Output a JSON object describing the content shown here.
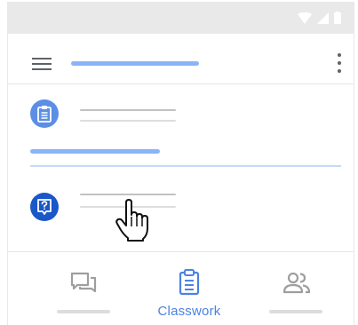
{
  "app_bar": {
    "menu_icon": "menu-icon",
    "more_icon": "more-vert-icon"
  },
  "items": [
    {
      "icon": "assignment-icon",
      "icon_color": "#5b8fe6"
    },
    {
      "icon": "question-icon",
      "icon_color": "#1a57c8"
    }
  ],
  "bottom_nav": {
    "items": [
      {
        "icon": "stream-icon",
        "label": ""
      },
      {
        "icon": "classwork-icon",
        "label": "Classwork",
        "active": true
      },
      {
        "icon": "people-icon",
        "label": ""
      }
    ],
    "active_color": "#4a83e0"
  },
  "colors": {
    "accent": "#8ab4f8",
    "status_bar": "#e9e9e9"
  }
}
